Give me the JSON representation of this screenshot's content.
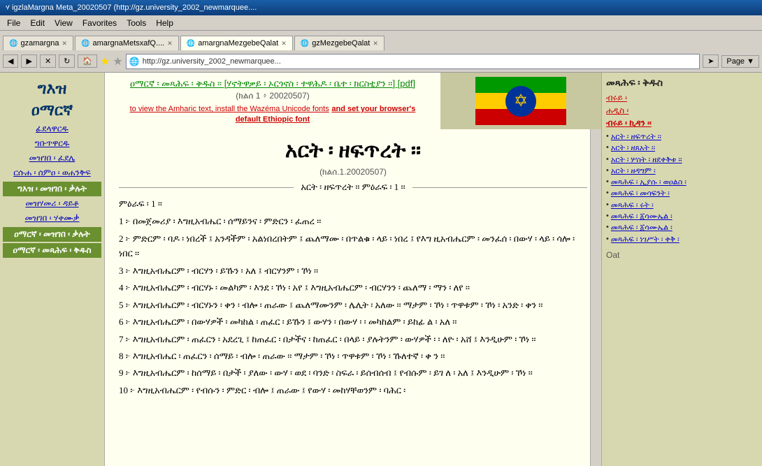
{
  "titlebar": {
    "text": "ሃ igzlaMargna Meta_20020507 (http://gz.university_2002_newmarquee...."
  },
  "menubar": {
    "items": [
      "File",
      "Edit",
      "View",
      "Favorites",
      "Tools",
      "Help"
    ]
  },
  "tabs": [
    {
      "label": "gzamargnа",
      "active": false
    },
    {
      "label": "amargnaMetsхafQ....",
      "active": false
    },
    {
      "label": "amargnaMezgebeQalat",
      "active": true
    },
    {
      "label": "gzMezgebeQalat",
      "active": false
    }
  ],
  "toolbar": {
    "address": "http://gz.university_2002_newmarquee..."
  },
  "logo": {
    "line1": "ግእዝ",
    "line2": "ዐማርኛ"
  },
  "header": {
    "top_link": "ዐማርኛ ፡ መጻሕፍ ፡ ቅዱስ ፡፡ [ሃኖትዋቃይ ፡ ኦርጎኖስ ፡ ተዋሕዶ ፡ ቤተ ፡ ክርስቲያን ፡፡] [pdf]",
    "ref": "(ክልሰ 1 ፥ 20020507)",
    "notice": "to view the Amharic text, install the Wazéma Unicode fonts",
    "notice2": "and set your browser's default Ethiopic font"
  },
  "sidebar_left": {
    "logo_line1": "ግእዝ",
    "logo_line2": "ዐማርኛ",
    "links": [
      {
        "label": "ፊደላዋርዱ",
        "active": false
      },
      {
        "label": "ግቡጥዋርዱ",
        "active": false
      },
      {
        "label": "መዝገበ ፡ ፈደሌ",
        "active": false
      },
      {
        "label": "ርሱሐ ፡ ሰምዐ ፡ ወሐንቅፍ",
        "active": false
      },
      {
        "label": "ግእዝ ፡ መዝገበ ፡ ቃሉት",
        "active": true
      },
      {
        "label": "መዝሃመሪ ፡ ዳይቶ",
        "active": false
      },
      {
        "label": "መዝገበ ፡ ሃቀሙቃ",
        "active": false
      },
      {
        "label": "ዐማርኛ ፡ መዝገበ ፡ ቃሉት",
        "active": true,
        "green": true
      },
      {
        "label": "ዐማርኛ ፡ መጻሕፍ ፡ ቅዱስ",
        "active": false,
        "green": true
      }
    ]
  },
  "main": {
    "big_title": "አርት ፡ ዘፍጥረት ፡፡",
    "ref_small": "(ክልሰ.1.20020507)",
    "divider_text": "አርት ፡ ዘፍጥረት ፡፡ ምዕራፍ ፡ 1 ፡፡",
    "section_label": "ምዕራፍ ፡ 1 ፡፡",
    "verses": [
      "1 ፦ በመጀመሪያ ፡ እግዚአብሔር ፡ ሰማይንና ፡ ምድርን ፡ ፈጠረ ፡፡",
      "2 ፦ ምድርም ፡ ባዶ ፡ ነበረች ፤ አንዳችም ፡ አልነበረበትም ፤ ጨለማሙ ፡ በጥልቁ ፡ ላይ ፡ ነበረ ፤ የእግ ዚአብሔርም ፡ መንፈሰ ፡ በውሃ ፡ ላይ ፡ ሳሎ ፡ ነበር ፡፡",
      "3 ፦ እግዚአብሔርም ፡ ብርሃን ፡ ይኹን ፡ አለ ፤ ብርሃንም ፡ ኾነ ፡፡",
      "4 ፦ እግዚአብሔርም ፡ ብርሃኑ ፡ መልካም ፡ እንደ ፡ ኾነ ፡ አየ ፤ እግዚአብሔርም ፡ ብርሃንን ፡ ጨለማ ፡ ማን ፡ ለየ ፡፡",
      "5 ፦ እግዚአብሔርም ፡ ብርሃኑን ፡ ቀን ፡ ብሎ ፡ ጠራው ፤ ጨለማሙንም ፡ ሌሊት ፡ አለው ፡፡ ማታም ፡ ኾነ ፡ ጥዋቱም ፡ ኾነ ፡ አንድ ፡ ቀን ፡፡",
      "6 ፦ እግዚአብሔርም ፡ በውሃዎች ፡ መካከል ፡ ጠፈር ፡ ይኹን ፤ ውሃን ፡ በውሃ ፡ ፡ መካከልም ፡ ይከፊ ል ፡ አለ ፡፡",
      "7 ፦ እግዚአብሔርም ፡ ጠፈርን ፡ አደረጊ ፤ ከጠፈር ፡ በታችና ፡ ከጠፈር ፡ በላይ ፡ ያሉትንም ፡ ውሃዎች ፡  ፡ ለዮ ፡ አሸ ፤ እንዲሁም ፡ ኾነ ፡፡",
      "8 ፦ እግዚአብሔር ፡ ጠፈርን ፡ ሰማይ ፡ ብሎ ፡ ጠራው ፡፡ ማታም ፡ ኾነ ፡ ጥዋቱም ፡ ኾነ ፡ ኹለተኛ ፡ ቀ ን ፡፡",
      "9 ፦ እግዚአብሔርም ፡ ከሰማይ ፡ በታች ፡ ያለው ፡ ውሃ ፡ ወደ ፡ ባንድ ፡ ስፍራ ፡ ይሰብሰብ ፤ የብሱም ፡ ይገ ለ ፡ አለ ፤ እንዲሁም ፡ ኾነ ፡፡",
      "10 ፦ እግዚአብሔርም ፡ የብሱን ፡ ምድር ፡ ብሎ ፤ ጠራው ፤ የውሃ ፡ መከሃቸወንም ፡ ባሕር ፡"
    ]
  },
  "sidebar_right": {
    "title": "መጻሕፍ ፡ ቅዱስ",
    "link1": "ብሩይ ፡",
    "link2": "ሐዲስ ፡",
    "link3": "ብሩይ ፡ ኪዳን ፡፡",
    "bullets": [
      "አርት ፡ ዘፍጥረት ፡፡",
      "አርት ፡ ዘጸአት ፡፡",
      "አርት ፡ ሦስት ፡ ዘደቀቅቱ ፡፡",
      "አርት ፡ ዘዳግም ፡",
      "መጻሕፍ ፡ ኢያሱ ፡ ወዐልስ ፡",
      "መጻሕፍ ፡ መሳፍንት ፡",
      "መጻሕፍ ፡ ሩት ፡",
      "መጻሕፍ ፡ ፩ሳሙኤል ፡",
      "መጻሕፍ ፡ ፩ሳሙኤል ፡",
      "መጻሕፍ ፡ ነገሥት ፡ ቀቅ ፡"
    ],
    "oat_label": "Oat"
  }
}
